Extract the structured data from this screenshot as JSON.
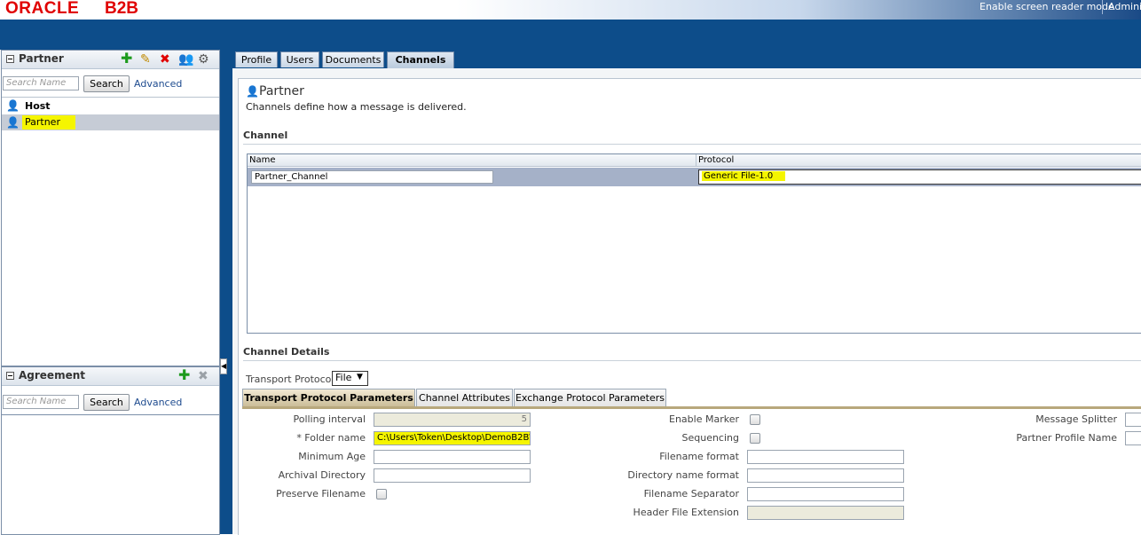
{
  "header": {
    "brand": "ORACLE",
    "product": "B2B",
    "reader_mode_link": "Enable screen reader mode",
    "admin_link": "Adminis"
  },
  "partner_panel": {
    "title": "Partner",
    "search_placeholder": "Search Name",
    "search_button": "Search",
    "advanced_link": "Advanced",
    "items": [
      {
        "label": "Host"
      },
      {
        "label": "Partner"
      }
    ]
  },
  "agreement_panel": {
    "title": "Agreement",
    "search_placeholder": "Search Name",
    "search_button": "Search",
    "advanced_link": "Advanced"
  },
  "tabs": [
    {
      "label": "Profile"
    },
    {
      "label": "Users"
    },
    {
      "label": "Documents"
    },
    {
      "label": "Channels"
    }
  ],
  "main": {
    "title": "Partner",
    "description": "Channels define how a message is delivered.",
    "channel_section": "Channel",
    "grid": {
      "columns": [
        "Name",
        "Protocol"
      ],
      "rows": [
        {
          "name": "Partner_Channel",
          "protocol": "Generic File-1.0"
        }
      ]
    },
    "details_section": "Channel Details",
    "transport_protocol_label": "Transport Protocol",
    "transport_protocol_value": "File",
    "subtabs": [
      {
        "label": "Transport Protocol Parameters"
      },
      {
        "label": "Channel Attributes"
      },
      {
        "label": "Exchange Protocol Parameters"
      }
    ],
    "params": {
      "polling_interval_label": "Polling interval",
      "polling_interval_value": "5",
      "folder_name_label": "* Folder name",
      "folder_name_value": "C:\\Users\\Token\\Desktop\\DemoB2B\\",
      "minimum_age_label": "Minimum Age",
      "archival_directory_label": "Archival Directory",
      "preserve_filename_label": "Preserve Filename",
      "enable_marker_label": "Enable Marker",
      "sequencing_label": "Sequencing",
      "filename_format_label": "Filename format",
      "directory_name_format_label": "Directory name format",
      "filename_separator_label": "Filename Separator",
      "header_file_extension_label": "Header File Extension",
      "message_splitter_label": "Message Splitter",
      "partner_profile_name_label": "Partner Profile Name"
    }
  },
  "colors": {
    "brand_red": "#e00000",
    "header_blue": "#0d4d8a",
    "highlight": "#f5f500"
  }
}
